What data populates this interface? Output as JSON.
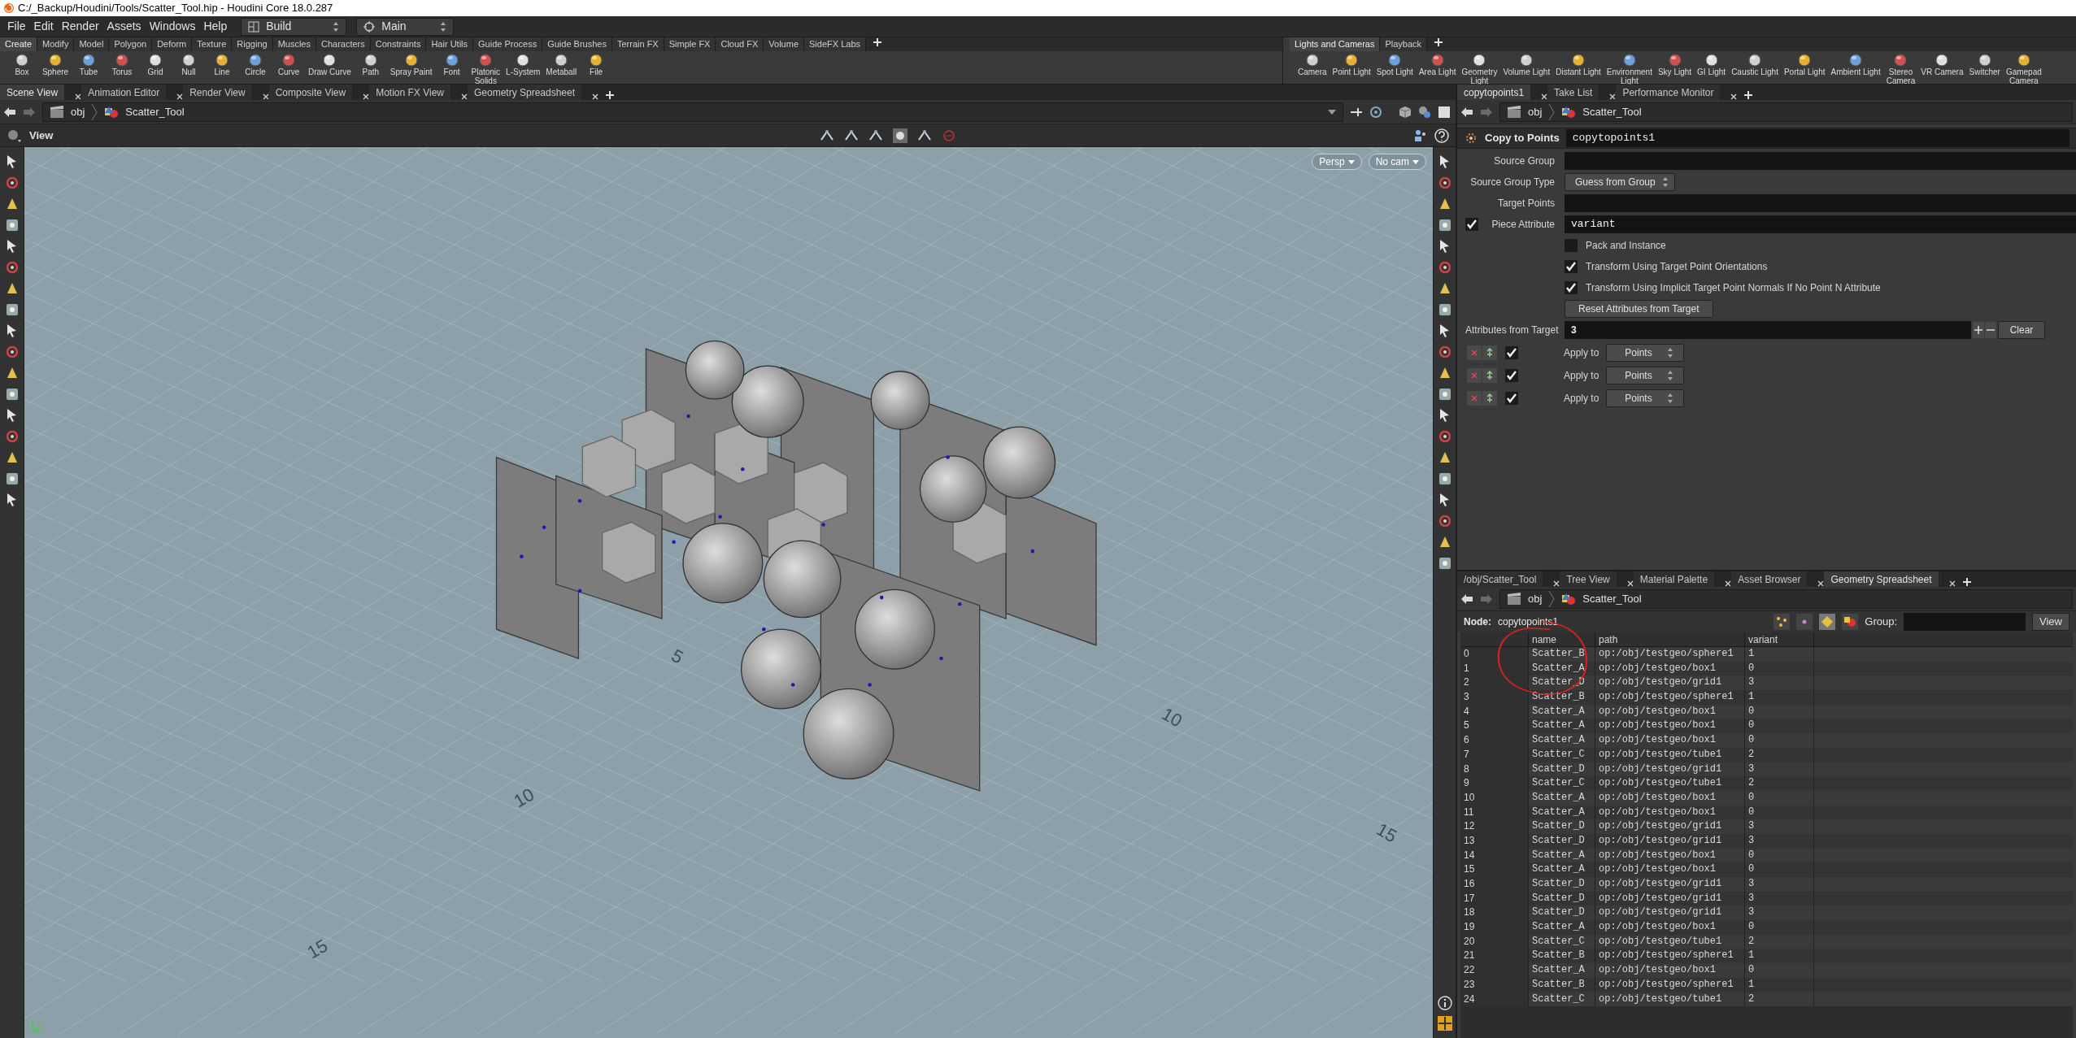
{
  "window": {
    "title": "C:/_Backup/Houdini/Tools/Scatter_Tool.hip - Houdini Core 18.0.287"
  },
  "menu": [
    "File",
    "Edit",
    "Render",
    "Assets",
    "Windows",
    "Help"
  ],
  "desktops": [
    {
      "kind": "desktop",
      "label": "Build"
    },
    {
      "kind": "set",
      "label": "Main"
    }
  ],
  "shelf_left": {
    "tabs": [
      {
        "label": "Create",
        "selected": true
      },
      {
        "label": "Modify",
        "selected": false
      },
      {
        "label": "Model",
        "selected": false
      },
      {
        "label": "Polygon",
        "selected": false
      },
      {
        "label": "Deform",
        "selected": false
      },
      {
        "label": "Texture",
        "selected": false
      },
      {
        "label": "Rigging",
        "selected": false
      },
      {
        "label": "Muscles",
        "selected": false
      },
      {
        "label": "Characters",
        "selected": false
      },
      {
        "label": "Constraints",
        "selected": false
      },
      {
        "label": "Hair Utils",
        "selected": false
      },
      {
        "label": "Guide Process",
        "selected": false
      },
      {
        "label": "Guide Brushes",
        "selected": false
      },
      {
        "label": "Terrain FX",
        "selected": false
      },
      {
        "label": "Simple FX",
        "selected": false
      },
      {
        "label": "Cloud FX",
        "selected": false
      },
      {
        "label": "Volume",
        "selected": false
      },
      {
        "label": "SideFX Labs",
        "selected": false
      }
    ],
    "tools": [
      "Box",
      "Sphere",
      "Tube",
      "Torus",
      "Grid",
      "Null",
      "Line",
      "Circle",
      "Curve",
      "Draw Curve",
      "Path",
      "Spray Paint",
      "Font",
      "Platonic\nSolids",
      "L-System",
      "Metaball",
      "File"
    ]
  },
  "shelf_right": {
    "tabs": [
      {
        "label": "Lights and Cameras",
        "selected": true
      },
      {
        "label": "Playback",
        "selected": false
      }
    ],
    "tools": [
      "Camera",
      "Point Light",
      "Spot Light",
      "Area Light",
      "Geometry\nLight",
      "Volume Light",
      "Distant Light",
      "Environment\nLight",
      "Sky Light",
      "GI Light",
      "Caustic Light",
      "Portal Light",
      "Ambient Light",
      "Stereo\nCamera",
      "VR Camera",
      "Switcher",
      "Gamepad\nCamera"
    ]
  },
  "scene_pane": {
    "tabs": [
      {
        "label": "Scene View",
        "selected": true
      },
      {
        "label": "Animation Editor",
        "selected": false
      },
      {
        "label": "Render View",
        "selected": false
      },
      {
        "label": "Composite View",
        "selected": false
      },
      {
        "label": "Motion FX View",
        "selected": false
      },
      {
        "label": "Geometry Spreadsheet",
        "selected": false
      }
    ],
    "path": [
      "obj",
      "Scatter_Tool"
    ],
    "view_title": "View",
    "projection": "Persp",
    "camera": "No cam",
    "grid_labels": [
      "5",
      "10",
      "15",
      "10",
      "15"
    ]
  },
  "param_pane": {
    "tabs": [
      {
        "label": "copytopoints1",
        "selected": true
      },
      {
        "label": "Take List",
        "selected": false
      },
      {
        "label": "Performance Monitor",
        "selected": false
      }
    ],
    "path": [
      "obj",
      "Scatter_Tool"
    ],
    "node_type": "Copy to Points",
    "node_name": "copytopoints1",
    "params": [
      {
        "kind": "field",
        "label": "Source Group"
      },
      {
        "kind": "menu",
        "label": "Source Group Type",
        "value": "Guess from Group"
      },
      {
        "kind": "field",
        "label": "Target Points"
      },
      {
        "kind": "toggle_field",
        "label": "Piece Attribute",
        "checked": true,
        "value": "variant"
      },
      {
        "kind": "checkbox",
        "label": "Pack and Instance",
        "checked": false
      },
      {
        "kind": "checkbox",
        "label": "Transform Using Target Point Orientations",
        "checked": true
      },
      {
        "kind": "checkbox",
        "label": "Transform Using Implicit Target Point Normals If No Point N Attribute",
        "checked": true
      },
      {
        "kind": "button",
        "label": "Reset Attributes from Target"
      },
      {
        "kind": "multiparm",
        "label": "Attributes from Target",
        "value": "3",
        "clear": "Clear"
      }
    ],
    "attributes": [
      {
        "checked": true,
        "label": "Apply to",
        "value": "Points"
      },
      {
        "checked": true,
        "label": "Apply to",
        "value": "Points"
      },
      {
        "checked": true,
        "label": "Apply to",
        "value": "Points"
      }
    ]
  },
  "spreadsheet_pane": {
    "tabs": [
      {
        "label": "/obj/Scatter_Tool",
        "selected": false
      },
      {
        "label": "Tree View",
        "selected": false
      },
      {
        "label": "Material Palette",
        "selected": false
      },
      {
        "label": "Asset Browser",
        "selected": false
      },
      {
        "label": "Geometry Spreadsheet",
        "selected": true
      }
    ],
    "path": [
      "obj",
      "Scatter_Tool"
    ],
    "node_label": "Node:",
    "node": "copytopoints1",
    "group_label": "Group:",
    "view_button": "View",
    "columns": [
      "",
      "name",
      "path",
      "variant"
    ],
    "rows": [
      [
        "0",
        "Scatter_B",
        "op:/obj/testgeo/sphere1",
        "1"
      ],
      [
        "1",
        "Scatter_A",
        "op:/obj/testgeo/box1",
        "0"
      ],
      [
        "2",
        "Scatter_D",
        "op:/obj/testgeo/grid1",
        "3"
      ],
      [
        "3",
        "Scatter_B",
        "op:/obj/testgeo/sphere1",
        "1"
      ],
      [
        "4",
        "Scatter_A",
        "op:/obj/testgeo/box1",
        "0"
      ],
      [
        "5",
        "Scatter_A",
        "op:/obj/testgeo/box1",
        "0"
      ],
      [
        "6",
        "Scatter_A",
        "op:/obj/testgeo/box1",
        "0"
      ],
      [
        "7",
        "Scatter_C",
        "op:/obj/testgeo/tube1",
        "2"
      ],
      [
        "8",
        "Scatter_D",
        "op:/obj/testgeo/grid1",
        "3"
      ],
      [
        "9",
        "Scatter_C",
        "op:/obj/testgeo/tube1",
        "2"
      ],
      [
        "10",
        "Scatter_A",
        "op:/obj/testgeo/box1",
        "0"
      ],
      [
        "11",
        "Scatter_A",
        "op:/obj/testgeo/box1",
        "0"
      ],
      [
        "12",
        "Scatter_D",
        "op:/obj/testgeo/grid1",
        "3"
      ],
      [
        "13",
        "Scatter_D",
        "op:/obj/testgeo/grid1",
        "3"
      ],
      [
        "14",
        "Scatter_A",
        "op:/obj/testgeo/box1",
        "0"
      ],
      [
        "15",
        "Scatter_A",
        "op:/obj/testgeo/box1",
        "0"
      ],
      [
        "16",
        "Scatter_D",
        "op:/obj/testgeo/grid1",
        "3"
      ],
      [
        "17",
        "Scatter_D",
        "op:/obj/testgeo/grid1",
        "3"
      ],
      [
        "18",
        "Scatter_D",
        "op:/obj/testgeo/grid1",
        "3"
      ],
      [
        "19",
        "Scatter_A",
        "op:/obj/testgeo/box1",
        "0"
      ],
      [
        "20",
        "Scatter_C",
        "op:/obj/testgeo/tube1",
        "2"
      ],
      [
        "21",
        "Scatter_B",
        "op:/obj/testgeo/sphere1",
        "1"
      ],
      [
        "22",
        "Scatter_A",
        "op:/obj/testgeo/box1",
        "0"
      ],
      [
        "23",
        "Scatter_B",
        "op:/obj/testgeo/sphere1",
        "1"
      ],
      [
        "24",
        "Scatter_C",
        "op:/obj/testgeo/tube1",
        "2"
      ]
    ]
  }
}
